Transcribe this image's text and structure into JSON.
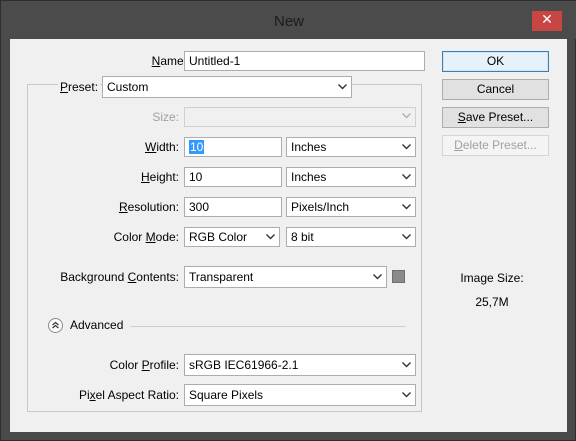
{
  "window": {
    "title": "New",
    "close_glyph": "✕"
  },
  "form": {
    "name": {
      "label": "Name:",
      "label_underline": "N",
      "label_rest": "ame:",
      "value": "Untitled-1"
    },
    "preset": {
      "label_underline": "P",
      "label_rest": "reset:",
      "value": "Custom"
    },
    "size": {
      "label": "Size:",
      "value": ""
    },
    "width": {
      "label_pre": "",
      "label_underline": "W",
      "label_rest": "idth:",
      "value": "10",
      "unit": "Inches"
    },
    "height": {
      "label_underline": "H",
      "label_rest": "eight:",
      "value": "10",
      "unit": "Inches"
    },
    "resolution": {
      "label_underline": "R",
      "label_rest": "esolution:",
      "value": "300",
      "unit": "Pixels/Inch"
    },
    "color_mode": {
      "label_pre": "Color ",
      "label_underline": "M",
      "label_rest": "ode:",
      "mode": "RGB Color",
      "depth": "8 bit"
    },
    "background": {
      "label_pre": "Background ",
      "label_underline": "C",
      "label_rest": "ontents:",
      "value": "Transparent"
    },
    "advanced": {
      "label": "Advanced"
    },
    "color_profile": {
      "label_pre": "Color ",
      "label_underline": "P",
      "label_rest": "rofile:",
      "value": "sRGB IEC61966-2.1"
    },
    "pixel_aspect": {
      "label_pre": "Pi",
      "label_underline": "x",
      "label_rest": "el Aspect Ratio:",
      "value": "Square Pixels"
    }
  },
  "buttons": {
    "ok": "OK",
    "cancel": "Cancel",
    "save_preset_underline": "S",
    "save_preset_rest": "ave Preset...",
    "delete_preset_underline": "D",
    "delete_preset_rest": "elete Preset..."
  },
  "image_size": {
    "label": "Image Size:",
    "value": "25,7M"
  },
  "colors": {
    "title_bg": "#4b4b4b",
    "dialog_bg": "#f0f0f0",
    "close_red": "#c74644",
    "selection_blue": "#3399ff",
    "swatch_gray": "#8a8a8a"
  },
  "icons": {
    "dropdown": "chevron-down-icon",
    "advanced": "double-chevron-up-icon",
    "close": "close-icon"
  }
}
